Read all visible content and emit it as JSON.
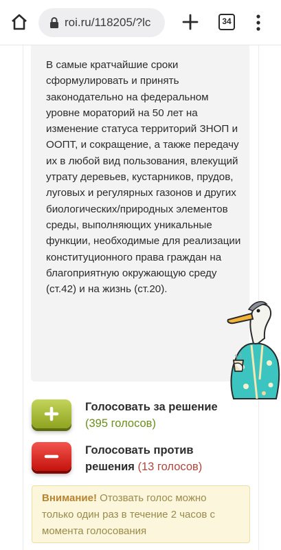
{
  "browser": {
    "url": "roi.ru/118205/?lc",
    "tab_count": "34",
    "icons": [
      "home-icon",
      "lock-icon",
      "plus-icon",
      "tabs-icon",
      "more-vert-icon"
    ]
  },
  "petition": {
    "text": "В самые кратчайшие сроки сформулировать и принять законодательно на федеральном уровне мораторий на 50 лет на изменение статуса территорий ЗНОП и ООПТ, и сокращение, а также передачу их в любой вид пользования, влекущий утрату деревьев, кустарников, прудов, луговых и регулярных газонов и других биологических/природных элементов среды, выполняющих уникальные функции, необходимые для реализации конституционного права граждан на благоприятную окружающую среду (ст.42) и на жизнь (ст.20)."
  },
  "votes": {
    "for_label": "Голосовать за решение",
    "for_count": "(395 голосов)",
    "for_color": "#9bb12a",
    "against_label": "Голосовать против решения",
    "against_count": "(13 голосов)",
    "against_color": "#d9241c"
  },
  "notice": {
    "title": "Внимание!",
    "text": "Отозвать голос можно только один раз в течение 2 часов с момента голосования"
  },
  "sticker": {
    "icon": "goose-in-kimono-sticker"
  }
}
